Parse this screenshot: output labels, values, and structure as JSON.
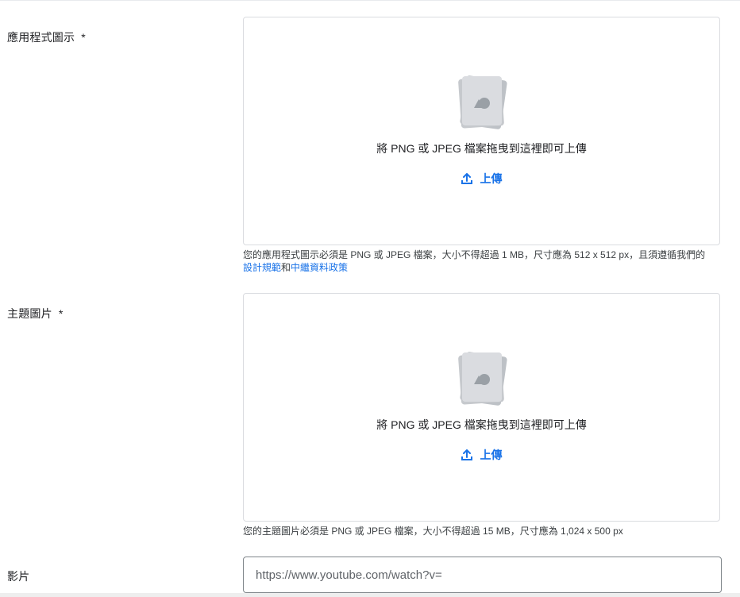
{
  "icon_field": {
    "label": "應用程式圖示",
    "required_mark": "*",
    "drop_text": "將 PNG 或 JPEG 檔案拖曳到這裡即可上傳",
    "upload_label": "上傳",
    "help_text": "您的應用程式圖示必須是 PNG 或 JPEG 檔案，大小不得超過 1 MB，尺寸應為 512 x 512 px，且須遵循我們的",
    "help_link_1": "設計規範",
    "help_joiner": "和",
    "help_link_2": "中繼資料政策"
  },
  "feature_field": {
    "label": "主題圖片",
    "required_mark": "*",
    "drop_text": "將 PNG 或 JPEG 檔案拖曳到這裡即可上傳",
    "upload_label": "上傳",
    "help_text": "您的主題圖片必須是 PNG 或 JPEG 檔案，大小不得超過 15 MB，尺寸應為 1,024 x 500 px"
  },
  "video_field": {
    "label": "影片",
    "placeholder": "https://www.youtube.com/watch?v=",
    "value": ""
  },
  "colors": {
    "accent": "#1a73e8",
    "border": "#dadce0",
    "text": "#202124"
  },
  "icons": {
    "dropzone_graphic": "image-placeholder-icon",
    "upload": "upload-icon"
  }
}
